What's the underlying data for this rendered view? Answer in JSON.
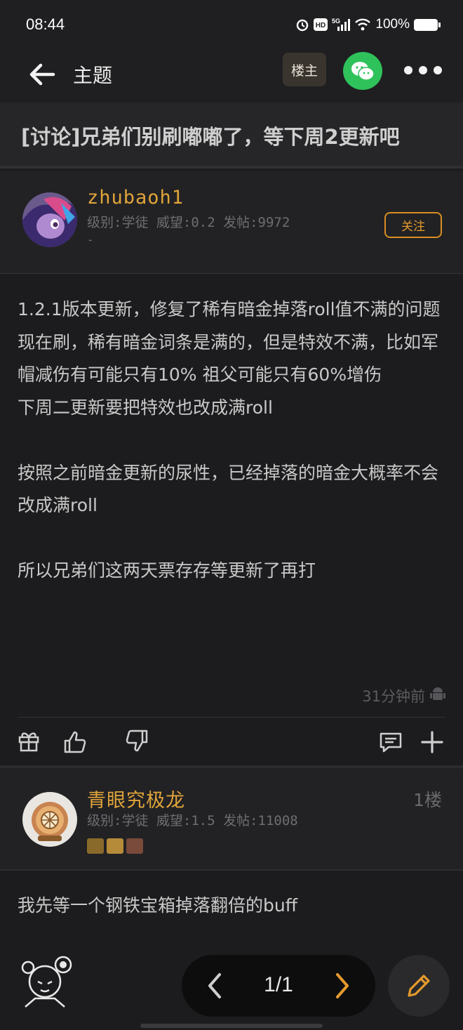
{
  "status_bar": {
    "time": "08:44",
    "network": "5G",
    "battery": "100%"
  },
  "header": {
    "title": "主题",
    "op_label": "楼主"
  },
  "topic": {
    "title": "[讨论]兄弟们别刷嘟嘟了，等下周2更新吧"
  },
  "author": {
    "name": "zhubaoh1",
    "meta": "级别:学徒 威望:0.2 发帖:9972",
    "meta2": "-",
    "follow_label": "关注"
  },
  "post": {
    "lines": [
      "1.2.1版本更新，修复了稀有暗金掉落roll值不满的问题",
      "现在刷，稀有暗金词条是满的，但是特效不满，比如军帽减伤有可能只有10% 祖父可能只有60%增伤",
      "下周二更新要把特效也改成满roll",
      "",
      "按照之前暗金更新的尿性，已经掉落的暗金大概率不会改成满roll",
      "",
      "所以兄弟们这两天票存存等更新了再打"
    ],
    "time": "31分钟前"
  },
  "reply": {
    "name": "青眼究极龙",
    "meta": "级别:学徒 威望:1.5 发帖:11008",
    "floor": "1楼",
    "text": "我先等一个钢铁宝箱掉落翻倍的buff"
  },
  "pager": {
    "label": "1/1"
  },
  "colors": {
    "accent": "#e0a43a",
    "background": "#1c1c1e",
    "wechat": "#2fc25b"
  },
  "icons": [
    "back-icon",
    "wechat-icon",
    "more-icon",
    "android-icon",
    "gift-icon",
    "like-icon",
    "dislike-icon",
    "comment-icon",
    "plus-icon",
    "chevron-left-icon",
    "chevron-right-icon",
    "edit-icon"
  ]
}
